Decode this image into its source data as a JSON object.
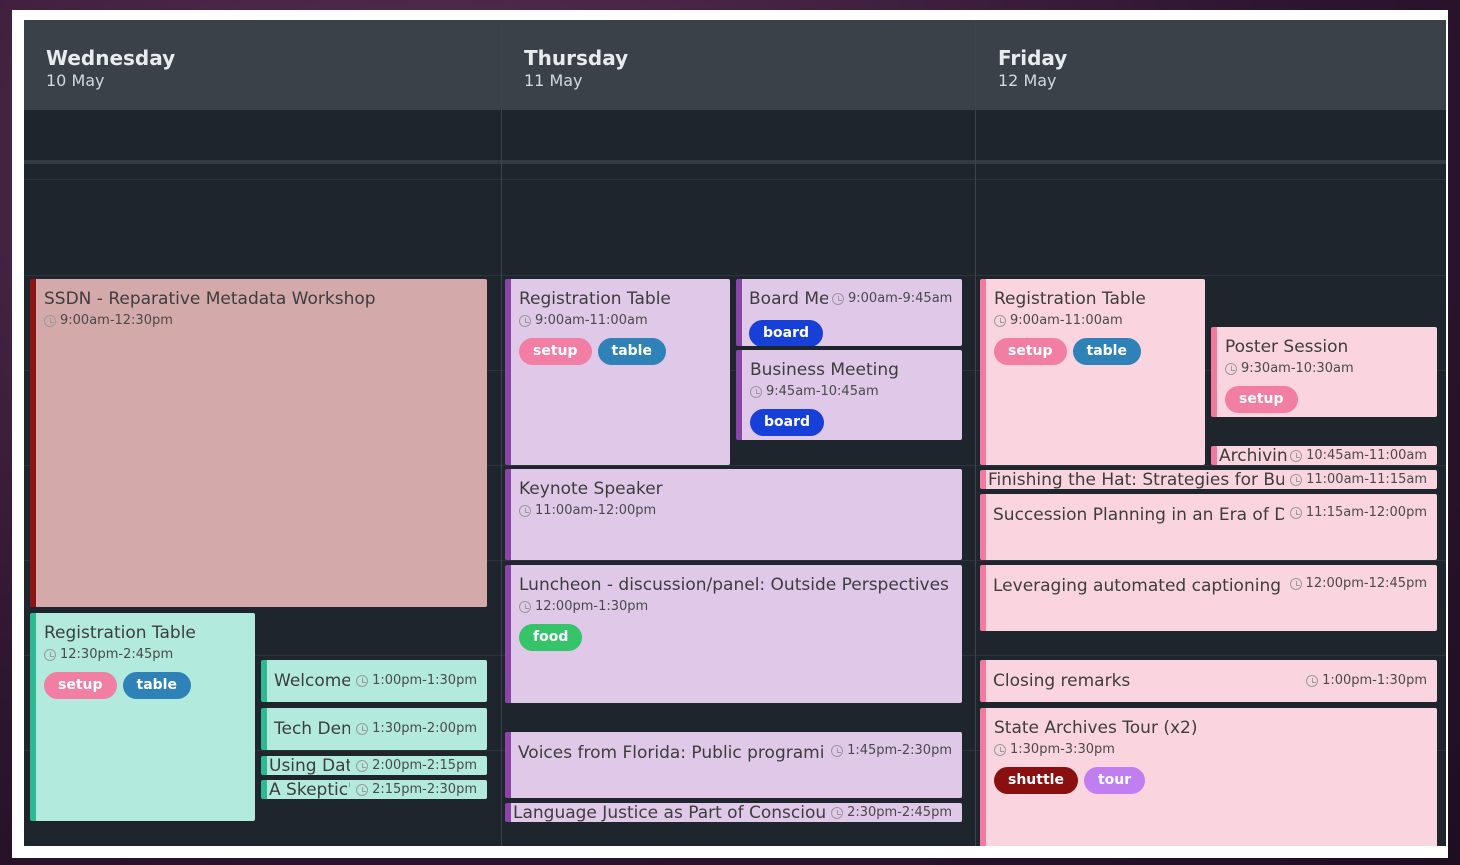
{
  "colors": {
    "setup": "#f27ea4",
    "table": "#2e82b7",
    "board": "#1740d8",
    "food": "#35c46a",
    "shuttle": "#8a0f0f",
    "tour": "#c07ef0"
  },
  "days": [
    {
      "name": "Wednesday",
      "date": "10 May"
    },
    {
      "name": "Thursday",
      "date": "11 May"
    },
    {
      "name": "Friday",
      "date": "12 May"
    }
  ],
  "events": {
    "wed_ssdn": {
      "title": "SSDN - Reparative Metadata Workshop",
      "time": "9:00am-12:30pm"
    },
    "wed_reg": {
      "title": "Registration Table",
      "time": "12:30pm-2:45pm",
      "tags": [
        "setup",
        "table"
      ]
    },
    "wed_welcome": {
      "title": "Welcome",
      "time": "1:00pm-1:30pm"
    },
    "wed_tech": {
      "title": "Tech Den",
      "time": "1:30pm-2:00pm"
    },
    "wed_using": {
      "title": "Using Data",
      "time": "2:00pm-2:15pm"
    },
    "wed_skeptic": {
      "title": "A Skeptic's",
      "time": "2:15pm-2:30pm"
    },
    "thu_reg": {
      "title": "Registration Table",
      "time": "9:00am-11:00am",
      "tags": [
        "setup",
        "table"
      ]
    },
    "thu_board": {
      "title": "Board Me",
      "time": "9:00am-9:45am",
      "tags": [
        "board"
      ]
    },
    "thu_business": {
      "title": "Business Meeting",
      "time": "9:45am-10:45am",
      "tags": [
        "board"
      ]
    },
    "thu_keynote": {
      "title": "Keynote Speaker",
      "time": "11:00am-12:00pm"
    },
    "thu_luncheon": {
      "title": "Luncheon - discussion/panel: Outside Perspectives",
      "time": "12:00pm-1:30pm",
      "tags": [
        "food"
      ]
    },
    "thu_voices": {
      "title": "Voices from Florida: Public programir",
      "time": "1:45pm-2:30pm"
    },
    "thu_language": {
      "title": "Language Justice as Part of Conscious",
      "time": "2:30pm-2:45pm"
    },
    "fri_reg": {
      "title": "Registration Table",
      "time": "9:00am-11:00am",
      "tags": [
        "setup",
        "table"
      ]
    },
    "fri_poster": {
      "title": "Poster Session",
      "time": "9:30am-10:30am",
      "tags": [
        "setup"
      ]
    },
    "fri_archiving": {
      "title": "Archiving",
      "time": "10:45am-11:00am"
    },
    "fri_hat": {
      "title": "Finishing the Hat: Strategies for Builc",
      "time": "11:00am-11:15am"
    },
    "fri_succession": {
      "title": "Succession Planning in an Era of De",
      "time": "11:15am-12:00pm"
    },
    "fri_captioning": {
      "title": "Leveraging automated captioning",
      "time": "12:00pm-12:45pm"
    },
    "fri_closing": {
      "title": "Closing remarks",
      "time": "1:00pm-1:30pm"
    },
    "fri_archives": {
      "title": "State Archives Tour (x2)",
      "time": "1:30pm-3:30pm",
      "tags": [
        "shuttle",
        "tour"
      ]
    }
  }
}
